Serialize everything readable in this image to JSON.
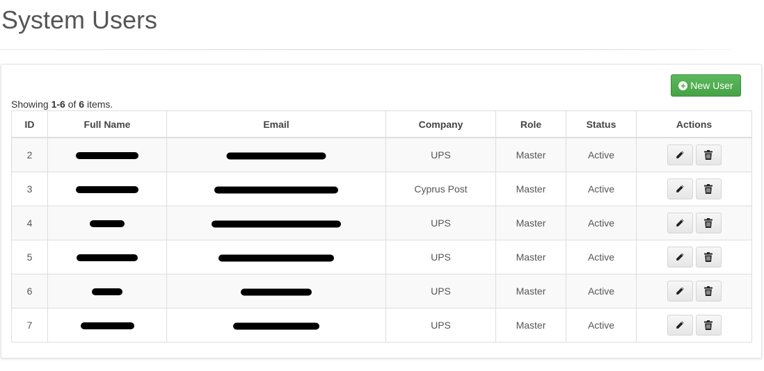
{
  "page": {
    "title": "System Users"
  },
  "toolbar": {
    "new_user_label": "New User"
  },
  "summary": {
    "prefix": "Showing ",
    "range": "1-6",
    "of": " of ",
    "total": "6",
    "suffix": " items."
  },
  "table": {
    "headers": [
      "ID",
      "Full Name",
      "Email",
      "Company",
      "Role",
      "Status",
      "Actions"
    ],
    "rows": [
      {
        "id": "2",
        "full_name": "[redacted]",
        "email": "[redacted]",
        "company": "UPS",
        "role": "Master",
        "status": "Active"
      },
      {
        "id": "3",
        "full_name": "[redacted]",
        "email": "[redacted]",
        "company": "Cyprus Post",
        "role": "Master",
        "status": "Active"
      },
      {
        "id": "4",
        "full_name": "[redacted]",
        "email": "[redacted]",
        "company": "UPS",
        "role": "Master",
        "status": "Active"
      },
      {
        "id": "5",
        "full_name": "[redacted]",
        "email": "[redacted]",
        "company": "UPS",
        "role": "Master",
        "status": "Active"
      },
      {
        "id": "6",
        "full_name": "[redacted]",
        "email": "[redacted]",
        "company": "UPS",
        "role": "Master",
        "status": "Active"
      },
      {
        "id": "7",
        "full_name": "[redacted]",
        "email": "[redacted]",
        "company": "UPS",
        "role": "Master",
        "status": "Active"
      }
    ]
  },
  "icons": {
    "new_user": "plus-circle-icon",
    "edit": "pencil-icon",
    "delete": "trash-icon"
  },
  "colors": {
    "primary_button": "#5cb85c",
    "text": "#555555",
    "stripe": "#f9f9f9"
  }
}
